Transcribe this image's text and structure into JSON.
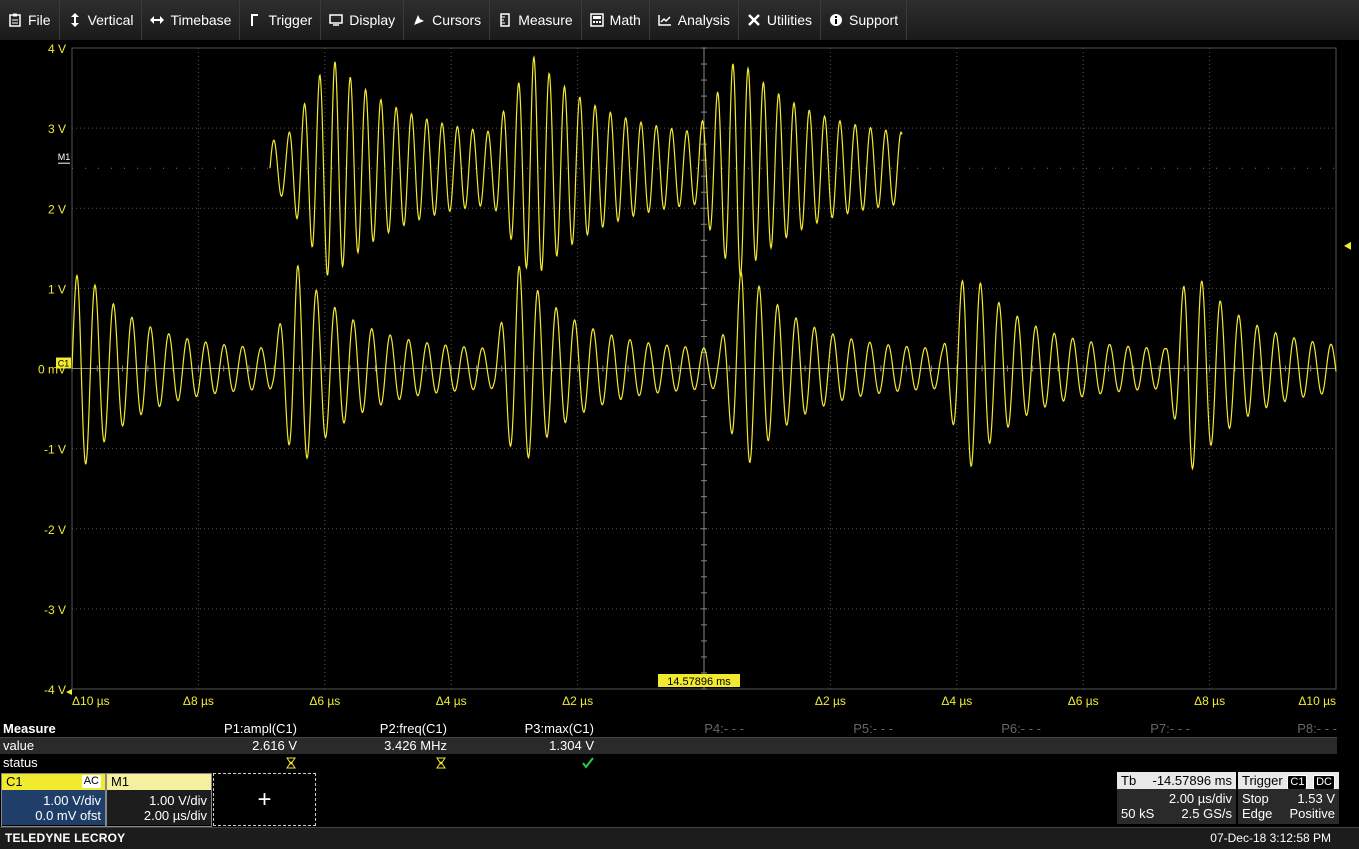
{
  "menu": [
    {
      "label": "File",
      "icon": "clipboard-icon"
    },
    {
      "label": "Vertical",
      "icon": "updown-arrow-icon"
    },
    {
      "label": "Timebase",
      "icon": "leftright-arrow-icon"
    },
    {
      "label": "Trigger",
      "icon": "trigger-edge-icon"
    },
    {
      "label": "Display",
      "icon": "monitor-icon"
    },
    {
      "label": "Cursors",
      "icon": "cursor-icon"
    },
    {
      "label": "Measure",
      "icon": "ruler-icon"
    },
    {
      "label": "Math",
      "icon": "calculator-icon"
    },
    {
      "label": "Analysis",
      "icon": "chart-icon"
    },
    {
      "label": "Utilities",
      "icon": "wrench-icon"
    },
    {
      "label": "Support",
      "icon": "info-icon"
    }
  ],
  "grid": {
    "y_labels": [
      "4 V",
      "3 V",
      "2 V",
      "1 V",
      "0 mV",
      "-1 V",
      "-2 V",
      "-3 V",
      "-4 V"
    ],
    "x_labels": [
      "Δ10 µs",
      "Δ8 µs",
      "Δ6 µs",
      "Δ4 µs",
      "Δ2 µs",
      "",
      "Δ2 µs",
      "Δ4 µs",
      "Δ6 µs",
      "Δ8 µs",
      "Δ10 µs"
    ],
    "center_time": "14.57896 ms",
    "c1_marker": "C1",
    "m1_marker": "M1"
  },
  "measure": {
    "title": "Measure",
    "row_value": "value",
    "row_status": "status",
    "params": [
      {
        "name": "P1:ampl(C1)",
        "value": "2.616 V",
        "status": "warn"
      },
      {
        "name": "P2:freq(C1)",
        "value": "3.426 MHz",
        "status": "warn"
      },
      {
        "name": "P3:max(C1)",
        "value": "1.304 V",
        "status": "ok"
      },
      {
        "name": "P4:- - -",
        "value": "",
        "status": ""
      },
      {
        "name": "P5:- - -",
        "value": "",
        "status": ""
      },
      {
        "name": "P6:- - -",
        "value": "",
        "status": ""
      },
      {
        "name": "P7:- - -",
        "value": "",
        "status": ""
      },
      {
        "name": "P8:- - -",
        "value": "",
        "status": ""
      }
    ]
  },
  "c1": {
    "label": "C1",
    "coupling": "AC",
    "vdiv": "1.00 V/div",
    "offset": "0.0 mV ofst"
  },
  "m1": {
    "label": "M1",
    "vdiv": "1.00 V/div",
    "tdiv": "2.00 µs/div"
  },
  "add_label": "+",
  "timebase": {
    "label": "Tb",
    "delay": "-14.57896 ms",
    "tdiv": "2.00 µs/div",
    "samples": "50 kS",
    "rate": "2.5 GS/s"
  },
  "trigger": {
    "label": "Trigger",
    "source": "C1",
    "coupling": "DC",
    "mode": "Stop",
    "level": "1.53 V",
    "type": "Edge",
    "slope": "Positive"
  },
  "footer": {
    "brand": "TELEDYNE LECROY",
    "datetime": "07-Dec-18 3:12:58 PM"
  },
  "colors": {
    "trace": "#f2ea2e",
    "grid": "#555555",
    "label": "#f2ea2e"
  },
  "waveform": {
    "c1_carrier_mhz": 3.426,
    "burst_peak_v": 1.3,
    "m1_offset_v": 2.5
  }
}
